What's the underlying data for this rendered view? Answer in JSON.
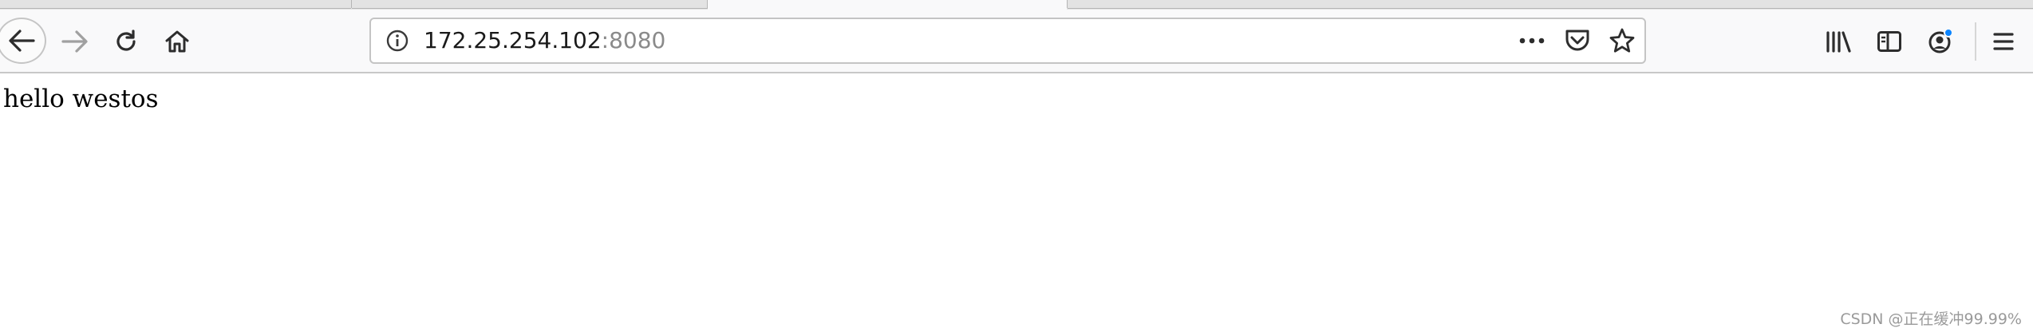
{
  "browser": {
    "address_bar": {
      "host": "172.25.254.102",
      "port": ":8080"
    },
    "icons": {
      "back": "back-arrow-icon",
      "forward": "forward-arrow-icon",
      "reload": "reload-icon",
      "home": "home-icon",
      "site_info": "info-icon",
      "page_actions": "more-dots-icon",
      "pocket": "pocket-icon",
      "bookmark": "star-icon",
      "library": "library-icon",
      "sidebar": "sidebar-icon",
      "account": "account-icon",
      "menu": "hamburger-menu-icon"
    },
    "colors": {
      "notification_dot": "#0a84ff",
      "toolbar_bg": "#f9f9fa",
      "port_text": "#8a8a8a"
    }
  },
  "page": {
    "content_text": "hello westos"
  },
  "watermark": {
    "text": "CSDN @正在缓冲99.99%"
  }
}
